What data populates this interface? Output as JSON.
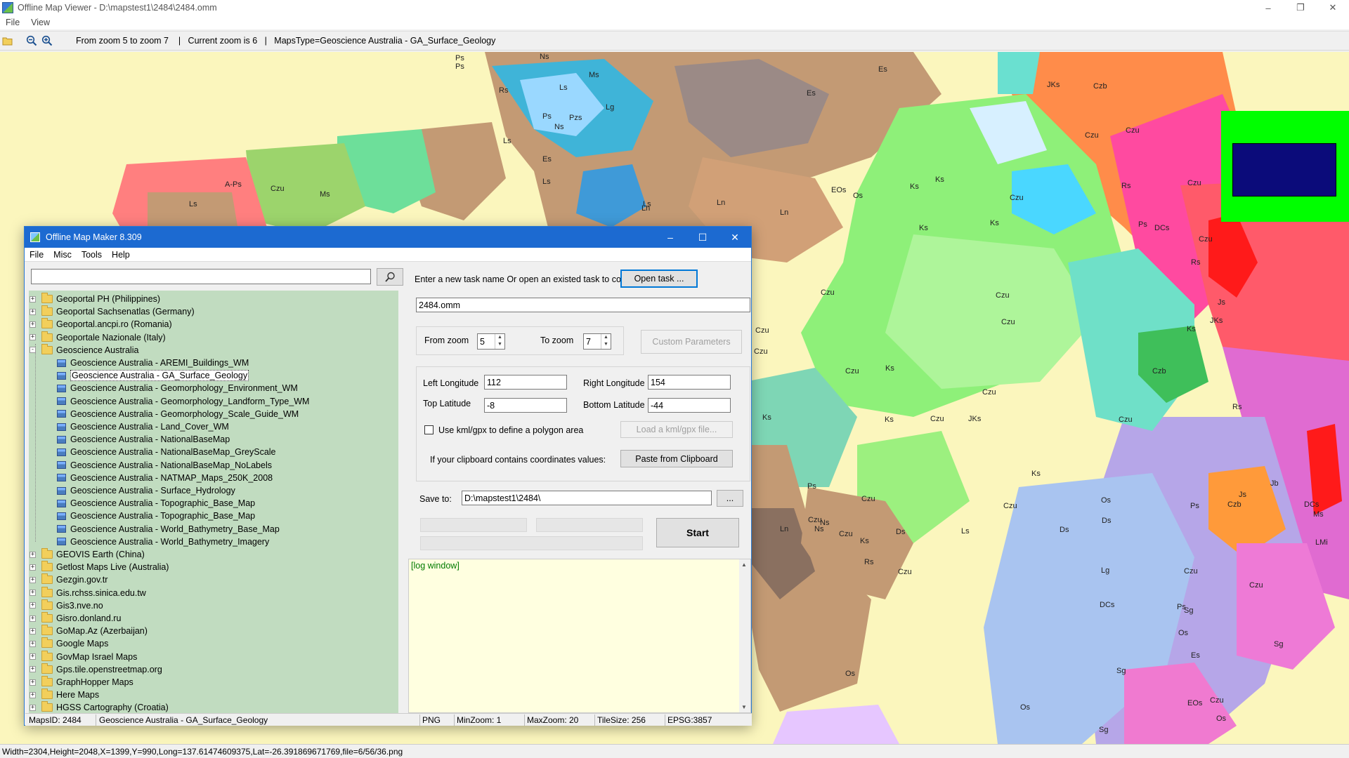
{
  "viewer": {
    "title": "Offline Map Viewer - D:\\mapstest1\\2484\\2484.omm",
    "menu": [
      "File",
      "View"
    ],
    "toolbar_info": "From zoom 5 to zoom 7    |   Current zoom is 6   |   MapsType=Geoscience Australia - GA_Surface_Geology",
    "status": "Width=2304,Height=2048,X=1399,Y=990,Long=137.61474609375,Lat=-26.391869671769,file=6/56/36.png",
    "map_labels": [
      "Ps",
      "Ps",
      "Ns",
      "Ms",
      "Es",
      "Es",
      "JKs",
      "Czb",
      "Ls",
      "Rs",
      "Lg",
      "Es",
      "Czu",
      "Czu",
      "Ps",
      "Pzs",
      "Ns",
      "Ls",
      "Ls",
      "A-Ps",
      "Czu",
      "Ms",
      "Ls",
      "Ls",
      "EOs",
      "Os",
      "Ks",
      "Ks",
      "Czu",
      "Rs",
      "Czu",
      "Ln",
      "Ln",
      "Ln",
      "Ps",
      "DCs",
      "Czu",
      "Rs",
      "Ks",
      "Ks",
      "Czu",
      "Czu",
      "Czu",
      "Js",
      "Czu",
      "JKs",
      "Ks",
      "Czu",
      "Ks",
      "Czu",
      "Czb",
      "Czu",
      "Ks",
      "Ks",
      "Czu",
      "Czu",
      "JKs",
      "Rs",
      "Ks",
      "Ps",
      "Czu",
      "Ks",
      "Czu",
      "Czu",
      "Czu",
      "Ns",
      "Os",
      "Ds",
      "Ds",
      "Czb",
      "Jb",
      "Js",
      "Ps",
      "DCs",
      "Ms",
      "LMi",
      "Ns",
      "Ln",
      "Ds",
      "Ls",
      "Lg",
      "Czu",
      "Rs",
      "Czu",
      "Czu",
      "DCs",
      "Sg",
      "Sg",
      "Ps",
      "Os",
      "Es",
      "Os",
      "Sg",
      "Czu",
      "EOs",
      "Os",
      "Sg",
      "Os"
    ]
  },
  "dialog": {
    "title": "Offline Map Maker 8.309",
    "menu": [
      "File",
      "Misc",
      "Tools",
      "Help"
    ],
    "search": {
      "value": ""
    },
    "tree": [
      {
        "label": "Geoportal PH (Philippines)",
        "level": 0,
        "expanded": false
      },
      {
        "label": "Geoportal Sachsenatlas (Germany)",
        "level": 0,
        "expanded": false
      },
      {
        "label": "Geoportal.ancpi.ro (Romania)",
        "level": 0,
        "expanded": false
      },
      {
        "label": "Geoportale Nazionale (Italy)",
        "level": 0,
        "expanded": false
      },
      {
        "label": "Geoscience Australia",
        "level": 0,
        "expanded": true
      },
      {
        "label": "Geoscience Australia - AREMI_Buildings_WM",
        "level": 1
      },
      {
        "label": "Geoscience Australia - GA_Surface_Geology",
        "level": 1,
        "selected": true
      },
      {
        "label": "Geoscience Australia - Geomorphology_Environment_WM",
        "level": 1
      },
      {
        "label": "Geoscience Australia - Geomorphology_Landform_Type_WM",
        "level": 1
      },
      {
        "label": "Geoscience Australia - Geomorphology_Scale_Guide_WM",
        "level": 1
      },
      {
        "label": "Geoscience Australia - Land_Cover_WM",
        "level": 1
      },
      {
        "label": "Geoscience Australia - NationalBaseMap",
        "level": 1
      },
      {
        "label": "Geoscience Australia - NationalBaseMap_GreyScale",
        "level": 1
      },
      {
        "label": "Geoscience Australia - NationalBaseMap_NoLabels",
        "level": 1
      },
      {
        "label": "Geoscience Australia - NATMAP_Maps_250K_2008",
        "level": 1
      },
      {
        "label": "Geoscience Australia - Surface_Hydrology",
        "level": 1
      },
      {
        "label": "Geoscience Australia - Topographic_Base_Map",
        "level": 1
      },
      {
        "label": "Geoscience Australia - Topographic_Base_Map",
        "level": 1
      },
      {
        "label": "Geoscience Australia - World_Bathymetry_Base_Map",
        "level": 1
      },
      {
        "label": "Geoscience Australia - World_Bathymetry_Imagery",
        "level": 1
      },
      {
        "label": "GEOVIS Earth (China)",
        "level": 0,
        "expanded": false
      },
      {
        "label": "Getlost Maps Live (Australia)",
        "level": 0,
        "expanded": false
      },
      {
        "label": "Gezgin.gov.tr",
        "level": 0,
        "expanded": false
      },
      {
        "label": "Gis.rchss.sinica.edu.tw",
        "level": 0,
        "expanded": false
      },
      {
        "label": "Gis3.nve.no",
        "level": 0,
        "expanded": false
      },
      {
        "label": "Gisro.donland.ru",
        "level": 0,
        "expanded": false
      },
      {
        "label": "GoMap.Az (Azerbaijan)",
        "level": 0,
        "expanded": false
      },
      {
        "label": "Google Maps",
        "level": 0,
        "expanded": false
      },
      {
        "label": "GovMap Israel Maps",
        "level": 0,
        "expanded": false
      },
      {
        "label": "Gps.tile.openstreetmap.org",
        "level": 0,
        "expanded": false
      },
      {
        "label": "GraphHopper Maps",
        "level": 0,
        "expanded": false
      },
      {
        "label": "Here Maps",
        "level": 0,
        "expanded": false
      },
      {
        "label": "HGSS Cartography (Croatia)",
        "level": 0,
        "expanded": false
      }
    ],
    "task_prompt": "Enter a new task name Or open an existed task to continue:",
    "open_task_label": "Open task ...",
    "task_name": "2484.omm",
    "from_zoom_label": "From zoom",
    "from_zoom": "5",
    "to_zoom_label": "To zoom",
    "to_zoom": "7",
    "custom_params_label": "Custom Parameters",
    "left_lon_label": "Left Longitude",
    "left_lon": "112",
    "right_lon_label": "Right Longitude",
    "right_lon": "154",
    "top_lat_label": "Top Latitude",
    "top_lat": "-8",
    "bottom_lat_label": "Bottom Latitude",
    "bottom_lat": "-44",
    "kml_checkbox_label": "Use kml/gpx to define a polygon area",
    "kml_checked": false,
    "load_kml_label": "Load a kml/gpx file...",
    "clipboard_prompt": "If your clipboard contains coordinates values:",
    "paste_label": "Paste from Clipboard",
    "save_to_label": "Save to:",
    "save_to": "D:\\mapstest1\\2484\\",
    "browse_label": "...",
    "start_label": "Start",
    "log_text": "[log window]",
    "status": {
      "maps_id": "MapsID: 2484",
      "maps_name": "Geoscience Australia - GA_Surface_Geology",
      "format": "PNG",
      "min_zoom": "MinZoom: 1",
      "max_zoom": "MaxZoom: 20",
      "tile_size": "TileSize: 256",
      "epsg": "EPSG:3857"
    }
  },
  "colors": {
    "title_blue": "#1c6ad1",
    "tree_bg": "#c1dcc0",
    "log_bg": "#ffffe0",
    "log_text": "#007a00",
    "map_base": "#fbf6bd",
    "minimap_bg": "#00ff00",
    "minimap_box": "#0b0b7a"
  }
}
